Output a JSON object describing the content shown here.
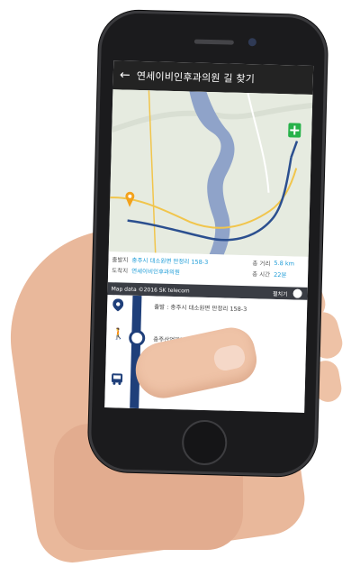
{
  "app": {
    "title": "연세이비인후과의원 길 찾기",
    "back_icon": "back-arrow-icon"
  },
  "summary": {
    "origin_label": "출발지",
    "origin_value": "충주시 대소원면 만정리 158-3",
    "destination_label": "도착지",
    "destination_value": "연세이비인후과의원",
    "distance_label": "총 거리",
    "distance_value": "5.8 km",
    "time_label": "총 시간",
    "time_value": "22분"
  },
  "map": {
    "attribution": "Map data ©2016 SK telecom",
    "expand_label": "펼치기",
    "river_color": "#8fa3c9",
    "route_color": "#2b4f8f",
    "road_color": "#f1c54c"
  },
  "route": {
    "steps": [
      {
        "icon": "location-pin-icon",
        "text": "출발 : 충주시 대소원면 만정리 158-3"
      },
      {
        "icon": "walk-icon",
        "text": "충주산업까지 도보 ( 약 4분 )"
      },
      {
        "icon": "bus-icon",
        "text": ""
      }
    ]
  }
}
